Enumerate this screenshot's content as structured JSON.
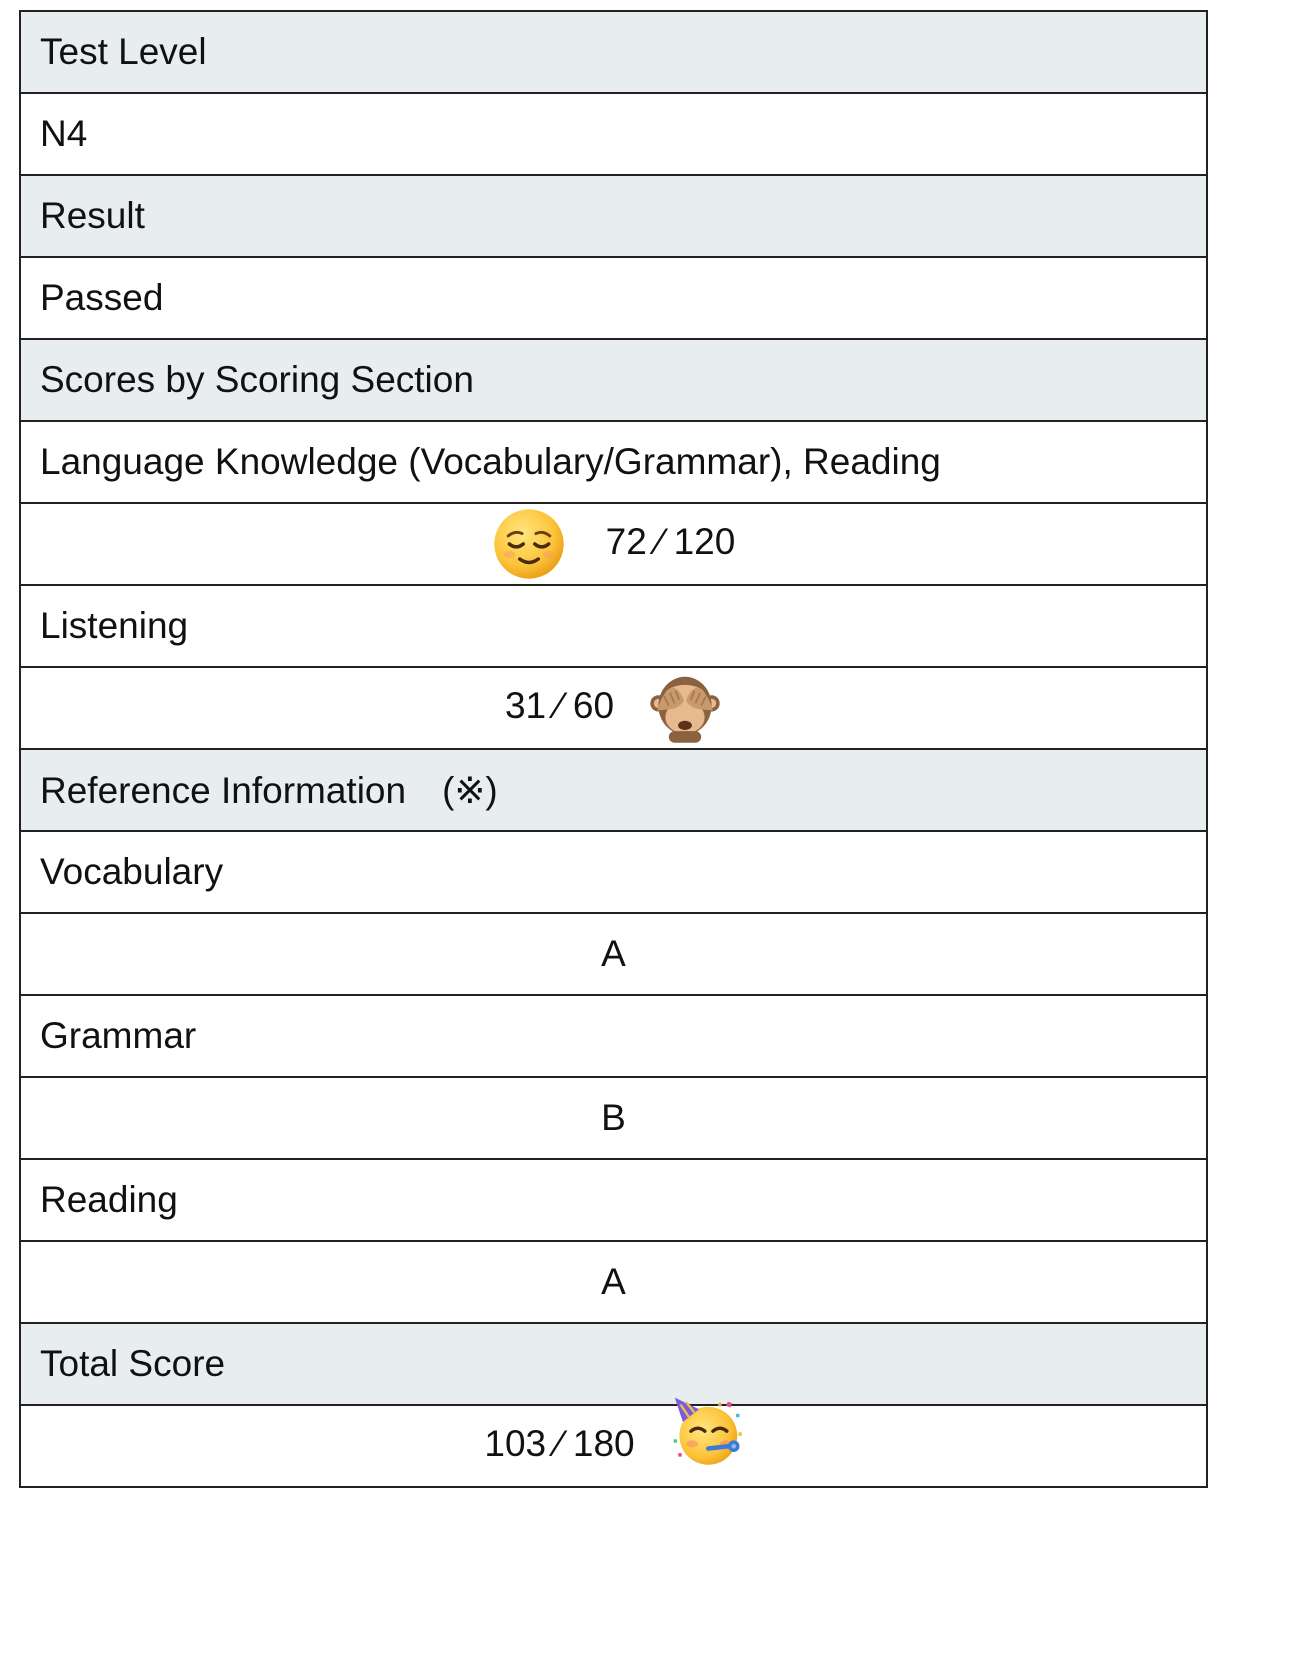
{
  "rows": {
    "test_level_label": "Test Level",
    "test_level_value": "N4",
    "result_label": "Result",
    "result_value": "Passed",
    "scores_label": "Scores by Scoring Section",
    "language_label": "Language Knowledge (Vocabulary/Grammar), Reading",
    "language_score": "72 ⁄ 120",
    "listening_label": "Listening",
    "listening_score": "31 ⁄ 60",
    "reference_label": "Reference Information",
    "reference_mark": "(※)",
    "vocabulary_label": "Vocabulary",
    "vocabulary_grade": "A",
    "grammar_label": "Grammar",
    "grammar_grade": "B",
    "reading_label": "Reading",
    "reading_grade": "A",
    "total_label": "Total Score",
    "total_score": "103 ⁄ 180"
  },
  "icons": {
    "language": "relieved-face-icon",
    "listening": "see-no-evil-monkey-icon",
    "total": "partying-face-icon"
  },
  "colors": {
    "header_background": "#e8edf0",
    "border": "#222222"
  }
}
